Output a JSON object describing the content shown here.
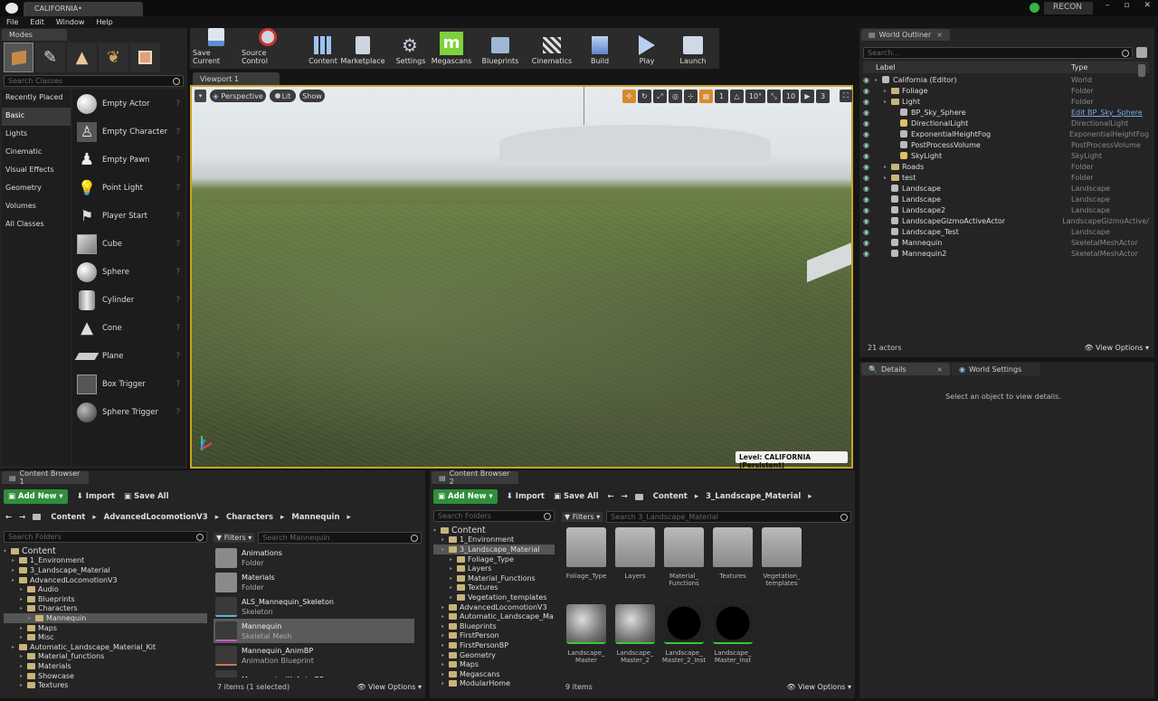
{
  "title_tab": "CALIFORNIA•",
  "menu": [
    "File",
    "Edit",
    "Window",
    "Help"
  ],
  "recon": "RECON",
  "modes": {
    "tab": "Modes",
    "search": "Search Classes",
    "categories": [
      "Recently Placed",
      "Basic",
      "Lights",
      "Cinematic",
      "Visual Effects",
      "Geometry",
      "Volumes",
      "All Classes"
    ],
    "items": [
      "Empty Actor",
      "Empty Character",
      "Empty Pawn",
      "Point Light",
      "Player Start",
      "Cube",
      "Sphere",
      "Cylinder",
      "Cone",
      "Plane",
      "Box Trigger",
      "Sphere Trigger"
    ]
  },
  "toolbar": [
    "Save Current",
    "Source Control",
    "Content",
    "Marketplace",
    "Settings",
    "Megascans",
    "Blueprints",
    "Cinematics",
    "Build",
    "Play",
    "Launch"
  ],
  "viewport": {
    "tab": "Viewport 1",
    "perspective": "Perspective",
    "lit": "Lit",
    "show": "Show",
    "grid": "1",
    "angle": "10°",
    "scale": "10",
    "speed": "3",
    "level": "Level:  CALIFORNIA (Persistent)"
  },
  "outliner": {
    "tab": "World Outliner",
    "search": "Search...",
    "col_label": "Label",
    "col_type": "Type",
    "rows": [
      {
        "label": "California (Editor)",
        "type": "World",
        "indent": 0
      },
      {
        "label": "Foliage",
        "type": "Folder",
        "indent": 1
      },
      {
        "label": "Light",
        "type": "Folder",
        "indent": 1
      },
      {
        "label": "BP_Sky_Sphere",
        "type": "Edit BP_Sky_Sphere",
        "indent": 2
      },
      {
        "label": "DirectionalLight",
        "type": "DirectionalLight",
        "indent": 2
      },
      {
        "label": "ExponentialHeightFog",
        "type": "ExponentialHeightFog",
        "indent": 2
      },
      {
        "label": "PostProcessVolume",
        "type": "PostProcessVolume",
        "indent": 2
      },
      {
        "label": "SkyLight",
        "type": "SkyLight",
        "indent": 2
      },
      {
        "label": "Roads",
        "type": "Folder",
        "indent": 1
      },
      {
        "label": "test",
        "type": "Folder",
        "indent": 1
      },
      {
        "label": "Landscape",
        "type": "Landscape",
        "indent": 1
      },
      {
        "label": "Landscape",
        "type": "Landscape",
        "indent": 1
      },
      {
        "label": "Landscape2",
        "type": "Landscape",
        "indent": 1
      },
      {
        "label": "LandscapeGizmoActiveActor",
        "type": "LandscapeGizmoActive/",
        "indent": 1
      },
      {
        "label": "Landscape_Test",
        "type": "Landscape",
        "indent": 1
      },
      {
        "label": "Mannequin",
        "type": "SkeletalMeshActor",
        "indent": 1
      },
      {
        "label": "Mannequin2",
        "type": "SkeletalMeshActor",
        "indent": 1
      }
    ],
    "count": "21 actors",
    "view_options": "View Options"
  },
  "details": {
    "tab": "Details",
    "tab2": "World Settings",
    "empty": "Select an object to view details."
  },
  "cb1": {
    "tab": "Content Browser 1",
    "add_new": "Add New",
    "import": "Import",
    "save_all": "Save All",
    "path": [
      "Content",
      "AdvancedLocomotionV3",
      "Characters",
      "Mannequin"
    ],
    "search_folders": "Search Folders",
    "filters": "Filters",
    "search_assets": "Search Mannequin",
    "tree": [
      {
        "t": "Content",
        "i": 0
      },
      {
        "t": "1_Environment",
        "i": 1
      },
      {
        "t": "3_Landscape_Material",
        "i": 1
      },
      {
        "t": "AdvancedLocomotionV3",
        "i": 1
      },
      {
        "t": "Audio",
        "i": 2
      },
      {
        "t": "Blueprints",
        "i": 2
      },
      {
        "t": "Characters",
        "i": 2
      },
      {
        "t": "Mannequin",
        "i": 3
      },
      {
        "t": "Maps",
        "i": 2
      },
      {
        "t": "Misc",
        "i": 2
      },
      {
        "t": "Automatic_Landscape_Material_Kit",
        "i": 1
      },
      {
        "t": "Material_functions",
        "i": 2
      },
      {
        "t": "Materials",
        "i": 2
      },
      {
        "t": "Showcase",
        "i": 2
      },
      {
        "t": "Textures",
        "i": 2
      }
    ],
    "assets": [
      {
        "n": "Animations",
        "t": "Folder"
      },
      {
        "n": "Materials",
        "t": "Folder"
      },
      {
        "n": "ALS_Mannequin_Skeleton",
        "t": "Skeleton"
      },
      {
        "n": "Mannequin",
        "t": "Skeletal Mesh"
      },
      {
        "n": "Mannequin_AnimBP",
        "t": "Animation Blueprint"
      },
      {
        "n": "Mannequin_IK_AnimBP",
        "t": ""
      }
    ],
    "status": "7 items (1 selected)",
    "view_options": "View Options"
  },
  "cb2": {
    "tab": "Content Browser 2",
    "add_new": "Add New",
    "import": "Import",
    "save_all": "Save All",
    "path": [
      "Content",
      "3_Landscape_Material"
    ],
    "search_folders": "Search Folders",
    "filters": "Filters",
    "search_assets": "Search 3_Landscape_Material",
    "tree": [
      {
        "t": "Content",
        "i": 0
      },
      {
        "t": "1_Environment",
        "i": 1
      },
      {
        "t": "3_Landscape_Material",
        "i": 1
      },
      {
        "t": "Foliage_Type",
        "i": 2
      },
      {
        "t": "Layers",
        "i": 2
      },
      {
        "t": "Material_Functions",
        "i": 2
      },
      {
        "t": "Textures",
        "i": 2
      },
      {
        "t": "Vegetation_templates",
        "i": 2
      },
      {
        "t": "AdvancedLocomotionV3",
        "i": 1
      },
      {
        "t": "Automatic_Landscape_Ma",
        "i": 1
      },
      {
        "t": "Blueprints",
        "i": 1
      },
      {
        "t": "FirstPerson",
        "i": 1
      },
      {
        "t": "FirstPersonBP",
        "i": 1
      },
      {
        "t": "Geometry",
        "i": 1
      },
      {
        "t": "Maps",
        "i": 1
      },
      {
        "t": "Megascans",
        "i": 1
      },
      {
        "t": "ModularHome",
        "i": 1
      }
    ],
    "assets": [
      {
        "n": "Foliage_Type",
        "k": "folder"
      },
      {
        "n": "Layers",
        "k": "folder"
      },
      {
        "n": "Material_ Functions",
        "k": "folder"
      },
      {
        "n": "Textures",
        "k": "folder"
      },
      {
        "n": "Vegetation_ templates",
        "k": "folder"
      },
      {
        "n": "Landscape_ Master",
        "k": "rock"
      },
      {
        "n": "Landscape_ Master_2",
        "k": "rock"
      },
      {
        "n": "Landscape_ Master_2_Inst",
        "k": "black"
      },
      {
        "n": "Landscape_ Master_Inst",
        "k": "black"
      }
    ],
    "status": "9 items",
    "view_options": "View Options"
  }
}
